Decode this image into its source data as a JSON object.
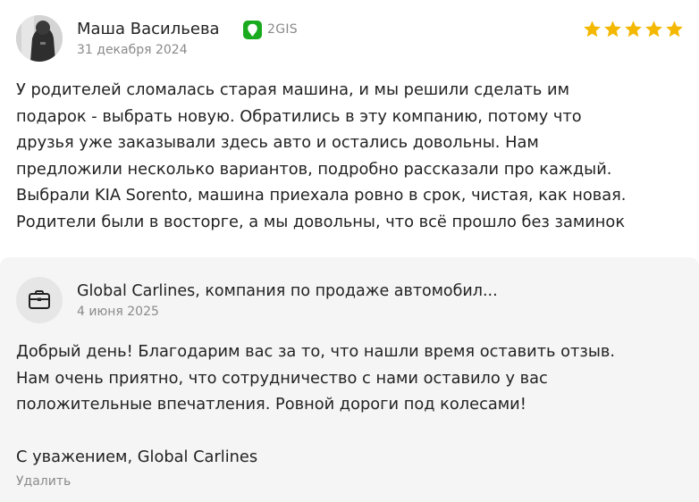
{
  "review": {
    "author": "Маша Васильева",
    "source": "2GIS",
    "source_icon": "2gis-logo-icon",
    "source_color": "#19aa1e",
    "date": "31 декабря 2024",
    "rating": 5,
    "rating_max": 5,
    "star_color": "#f5b800",
    "text_lines": [
      "У родителей сломалась старая машина, и мы решили сделать им",
      "подарок - выбрать новую. Обратились в эту компанию, потому что",
      "друзья уже заказывали здесь авто и остались довольны. Нам",
      "предложили несколько вариантов, подробно рассказали про каждый.",
      "Выбрали KIA Sorento, машина приехала ровно в срок, чистая, как новая.",
      "Родители были в восторге, а мы довольны, что всё прошло без заминок"
    ]
  },
  "reply": {
    "company": "Global Carlines, компания по продаже автомобил...",
    "company_icon": "briefcase-icon",
    "date": "4 июня 2025",
    "text_lines": [
      "Добрый день! Благодарим вас за то, что нашли время оставить отзыв.",
      "Нам очень приятно, что сотрудничество с нами оставило у вас",
      "положительные впечатления. Ровной дороги под колесами!",
      "",
      "С уважением, Global Carlines"
    ],
    "delete_label": "Удалить"
  }
}
